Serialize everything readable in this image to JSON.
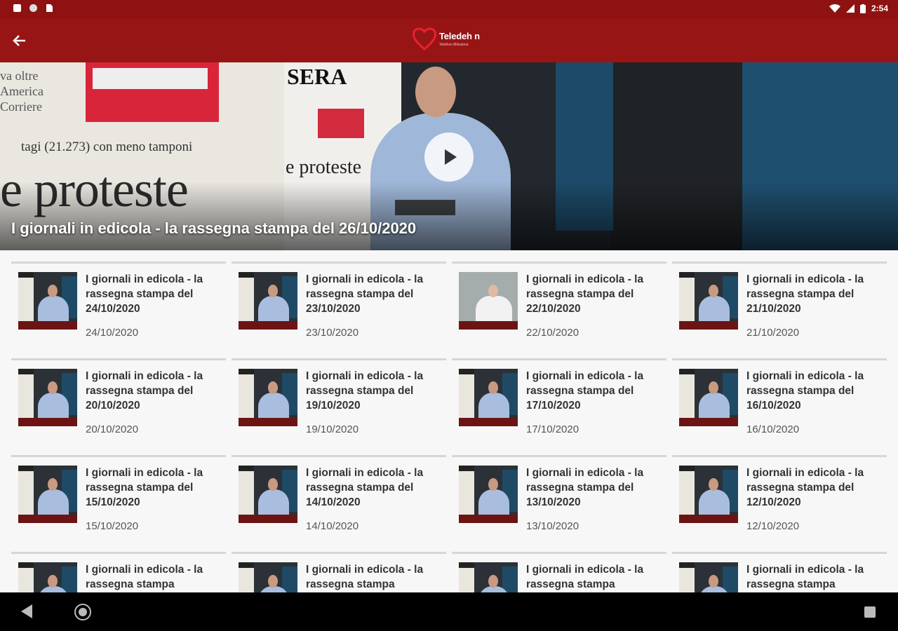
{
  "status_bar": {
    "time": "2:54"
  },
  "app_bar": {
    "logo_text": "Teledeh n",
    "logo_sub": "Telethon Milestone"
  },
  "hero": {
    "title": "I giornali in edicola - la rassegna stampa del 26/10/2020",
    "news_text_top": "va oltre\nAmerica\nCorriere",
    "news_text_mid": "tagi (21.273) con meno tamponi",
    "news_text_big": "e proteste",
    "paper_head": "SERA",
    "paper_big": "e proteste"
  },
  "items": [
    {
      "title": "I giornali in edicola - la rassegna stampa del 24/10/2020",
      "date": "24/10/2020"
    },
    {
      "title": "I giornali in edicola - la rassegna stampa del 23/10/2020",
      "date": "23/10/2020"
    },
    {
      "title": "I giornali in edicola - la rassegna stampa del 22/10/2020",
      "date": "22/10/2020"
    },
    {
      "title": "I giornali in edicola - la rassegna stampa del 21/10/2020",
      "date": "21/10/2020"
    },
    {
      "title": "I giornali in edicola - la rassegna stampa del 20/10/2020",
      "date": "20/10/2020"
    },
    {
      "title": "I giornali in edicola - la rassegna stampa del 19/10/2020",
      "date": "19/10/2020"
    },
    {
      "title": "I giornali in edicola - la rassegna stampa del 17/10/2020",
      "date": "17/10/2020"
    },
    {
      "title": "I giornali in edicola - la rassegna stampa del 16/10/2020",
      "date": "16/10/2020"
    },
    {
      "title": "I giornali in edicola - la rassegna stampa del 15/10/2020",
      "date": "15/10/2020"
    },
    {
      "title": "I giornali in edicola - la rassegna stampa del 14/10/2020",
      "date": "14/10/2020"
    },
    {
      "title": "I giornali in edicola - la rassegna stampa del 13/10/2020",
      "date": "13/10/2020"
    },
    {
      "title": "I giornali in edicola - la rassegna stampa del 12/10/2020",
      "date": "12/10/2020"
    },
    {
      "title": "I giornali in edicola - la rassegna stampa",
      "date": ""
    },
    {
      "title": "I giornali in edicola - la rassegna stampa",
      "date": ""
    },
    {
      "title": "I giornali in edicola - la rassegna stampa",
      "date": ""
    },
    {
      "title": "I giornali in edicola - la rassegna stampa",
      "date": ""
    }
  ]
}
